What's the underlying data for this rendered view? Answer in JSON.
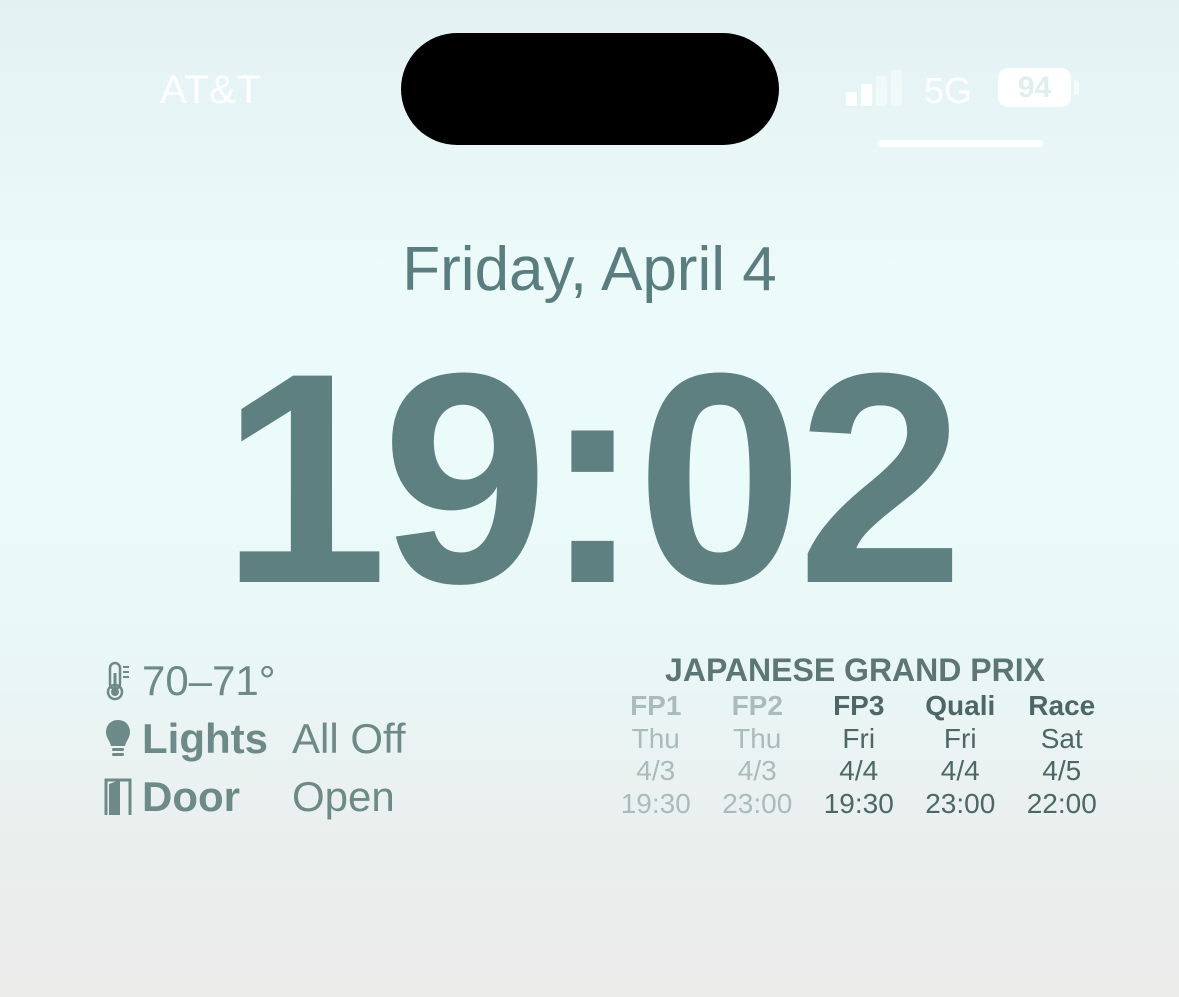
{
  "status_bar": {
    "carrier": "AT&T",
    "network": "5G",
    "battery": "94",
    "signal_bars_active": 2,
    "signal_bars_total": 4
  },
  "lock_screen": {
    "date": "Friday, April 4",
    "time": "19:02"
  },
  "widget_home": {
    "temperature": "70–71°",
    "lights_label": "Lights",
    "lights_value": "All Off",
    "door_label": "Door",
    "door_value": "Open",
    "icons": [
      "thermometer-icon",
      "lightbulb-icon",
      "door-icon"
    ]
  },
  "widget_f1": {
    "title": "JAPANESE GRAND PRIX",
    "sessions": [
      {
        "name": "FP1",
        "day": "Thu",
        "date": "4/3",
        "time": "19:30",
        "past": true
      },
      {
        "name": "FP2",
        "day": "Thu",
        "date": "4/3",
        "time": "23:00",
        "past": true
      },
      {
        "name": "FP3",
        "day": "Fri",
        "date": "4/4",
        "time": "19:30",
        "past": false
      },
      {
        "name": "Quali",
        "day": "Fri",
        "date": "4/4",
        "time": "23:00",
        "past": false
      },
      {
        "name": "Race",
        "day": "Sat",
        "date": "4/5",
        "time": "22:00",
        "past": false
      }
    ]
  },
  "colors": {
    "text_primary": "#5f8080",
    "text_past": "#a9bcbb",
    "status_text": "#ffffff"
  }
}
